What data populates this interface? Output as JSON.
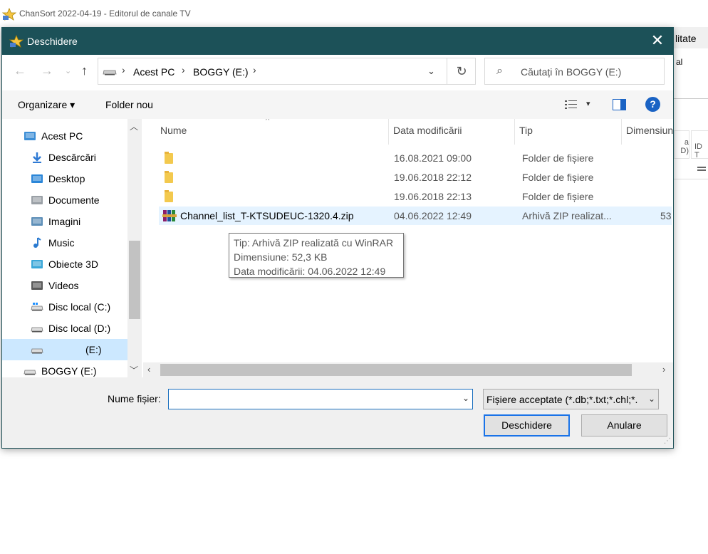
{
  "app": {
    "title": "ChanSort 2022-04-19 - Editorul de canale TV",
    "right_tab": "litate",
    "right_text": "al",
    "col_a": "a\nD)",
    "col_b": "ID T"
  },
  "dialog": {
    "title": "Deschidere",
    "close_label": "✕",
    "address": {
      "crumbs": [
        "Acest PC",
        "BOGGY (E:)"
      ],
      "refresh": "↻"
    },
    "search_placeholder": "Căutați în BOGGY (E:)",
    "toolbar": {
      "organize": "Organizare ▾",
      "new_folder": "Folder nou",
      "help": "?"
    },
    "nav": [
      {
        "label": "Acest PC",
        "icon": "pc-icon",
        "indent": 0
      },
      {
        "label": "Descărcări",
        "icon": "download-icon",
        "indent": 1
      },
      {
        "label": "Desktop",
        "icon": "desktop-icon",
        "indent": 1
      },
      {
        "label": "Documente",
        "icon": "documents-icon",
        "indent": 1
      },
      {
        "label": "Imagini",
        "icon": "pictures-icon",
        "indent": 1
      },
      {
        "label": "Music",
        "icon": "music-icon",
        "indent": 1
      },
      {
        "label": "Obiecte 3D",
        "icon": "objects3d-icon",
        "indent": 1
      },
      {
        "label": "Videos",
        "icon": "videos-icon",
        "indent": 1
      },
      {
        "label": "Disc local (C:)",
        "icon": "drive-c-icon",
        "indent": 1
      },
      {
        "label": "Disc local (D:)",
        "icon": "drive-icon",
        "indent": 1
      },
      {
        "label": "(E:)",
        "icon": "usb-drive-icon",
        "indent": 1,
        "selected": true
      },
      {
        "label": "BOGGY (E:)",
        "icon": "usb-drive-icon",
        "indent": 0
      }
    ],
    "columns": {
      "name": "Nume",
      "date": "Data modificării",
      "type": "Tip",
      "size": "Dimensiune"
    },
    "files": [
      {
        "name": "",
        "date": "16.08.2021 09:00",
        "type": "Folder de fișiere",
        "size": "",
        "kind": "folder"
      },
      {
        "name": "",
        "date": "19.06.2018 22:12",
        "type": "Folder de fișiere",
        "size": "",
        "kind": "folder"
      },
      {
        "name": "",
        "date": "19.06.2018 22:13",
        "type": "Folder de fișiere",
        "size": "",
        "kind": "folder"
      },
      {
        "name": "Channel_list_T-KTSUDEUC-1320.4.zip",
        "date": "04.06.2022 12:49",
        "type": "Arhivă ZIP realizat...",
        "size": "53",
        "kind": "zip"
      }
    ],
    "tooltip": {
      "line1": "Tip: Arhivă ZIP realizată cu WinRAR",
      "line2": "Dimensiune: 52,3 KB",
      "line3": "Data modificării: 04.06.2022 12:49"
    },
    "filename_label": "Nume fișier:",
    "filename_value": "",
    "filter_value": "Fișiere acceptate (*.db;*.txt;*.chl;*.",
    "open_button": "Deschidere",
    "cancel_button": "Anulare"
  }
}
